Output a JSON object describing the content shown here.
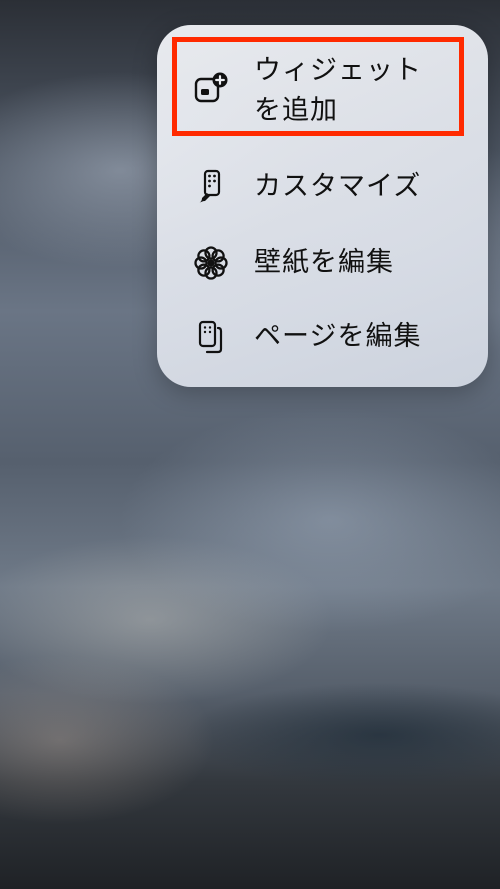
{
  "menu": {
    "items": [
      {
        "label": "ウィジェット\nを追加",
        "icon": "add-widget-icon"
      },
      {
        "label": "カスタマイズ",
        "icon": "customize-brush-icon"
      },
      {
        "label": "壁紙を編集",
        "icon": "flower-icon"
      },
      {
        "label": "ページを編集",
        "icon": "edit-pages-icon"
      }
    ]
  },
  "highlight_color": "#ff2a00"
}
